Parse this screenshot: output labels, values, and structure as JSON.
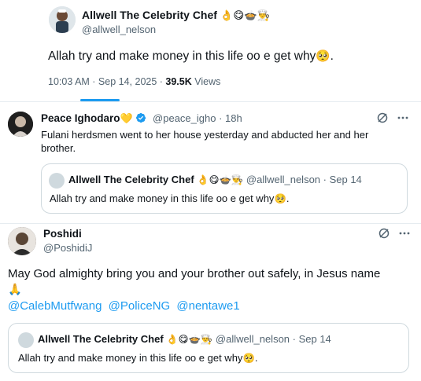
{
  "main_tweet": {
    "name": "Allwell The Celebrity Chef",
    "name_emojis": "👌😋🍲👨‍🍳",
    "handle": "@allwell_nelson",
    "text": "Allah try and make money in this life oo e get why",
    "text_emoji": "🥺",
    "text_end": ".",
    "time": "10:03 AM · Sep 14, 2025 · ",
    "views_count": "39.5K",
    "views_label": " Views"
  },
  "reply1": {
    "name": "Peace Ighodaro",
    "name_emoji": "💛",
    "handle": "@peace_igho · 18h",
    "text": "Fulani herdsmen went to her house yesterday and abducted her and her brother.",
    "quote": {
      "name": "Allwell The Celebrity Chef",
      "name_emojis": "👌😋🍲👨‍🍳",
      "handle": "@allwell_nelson · Sep 14",
      "text": "Allah try and make money in this life oo e get why",
      "text_emoji": "🥺",
      "text_end": "."
    }
  },
  "reply2": {
    "name": "Poshidi",
    "handle": "@PoshidiJ",
    "text": "May God almighty bring you and your brother out safely, in Jesus name",
    "text_emoji": "🙏",
    "mentions": [
      "@CalebMutfwang",
      "@PoliceNG",
      "@nentawe1"
    ],
    "quote": {
      "name": "Allwell The Celebrity Chef",
      "name_emojis": "👌😋🍲👨‍🍳",
      "handle": "@allwell_nelson · Sep 14",
      "text": "Allah try and make money in this life oo e get why",
      "text_emoji": "🥺",
      "text_end": "."
    }
  },
  "icons": {
    "grok": "grok-icon",
    "more": "more-icon",
    "verified": "verified-badge-icon"
  },
  "colors": {
    "accent": "#1d9bf0",
    "secondary_text": "#536471",
    "border": "#cfd9de"
  }
}
